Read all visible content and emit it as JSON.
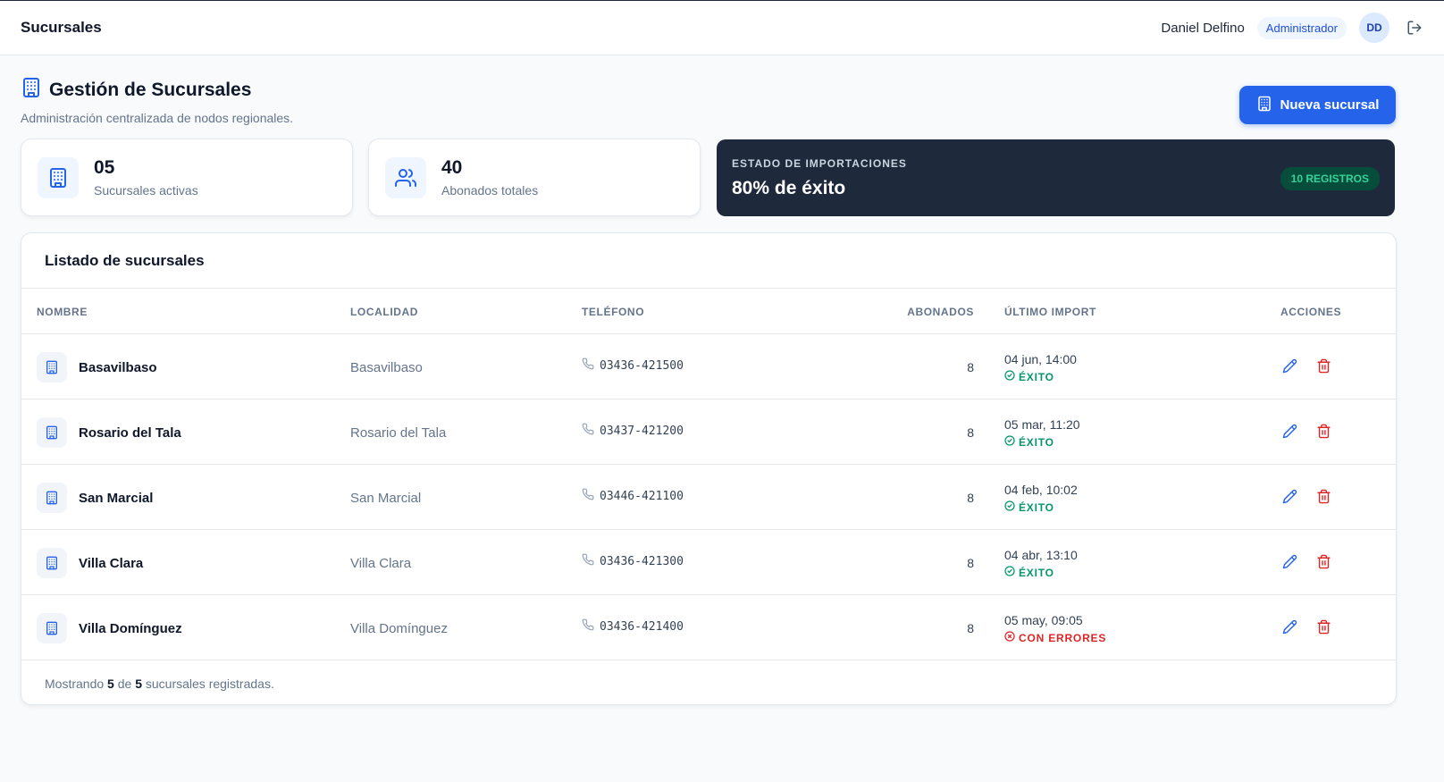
{
  "header": {
    "app_title": "Sucursales",
    "user_name": "Daniel Delfino",
    "role": "Administrador",
    "avatar_initials": "DD",
    "logout_icon": "logout-icon"
  },
  "page": {
    "title": "Gestión de Sucursales",
    "subtitle": "Administración centralizada de nodos regionales.",
    "new_button": "Nueva sucursal"
  },
  "stats": {
    "branches": {
      "value": "05",
      "label": "Sucursales activas"
    },
    "subscribers": {
      "value": "40",
      "label": "Abonados totales"
    }
  },
  "imports": {
    "caption": "ESTADO DE IMPORTACIONES",
    "success_text": "80% de éxito",
    "badge": "10 REGISTROS"
  },
  "table": {
    "title": "Listado de sucursales",
    "columns": [
      "NOMBRE",
      "LOCALIDAD",
      "TELÉFONO",
      "ABONADOS",
      "ÚLTIMO IMPORT",
      "ACCIONES"
    ],
    "rows": [
      {
        "name": "Basavilbaso",
        "locality": "Basavilbaso",
        "phone": "03436-421500",
        "subscribers": "8",
        "import_date": "04 jun, 14:00",
        "import_status": "ÉXITO",
        "ok": true
      },
      {
        "name": "Rosario del Tala",
        "locality": "Rosario del Tala",
        "phone": "03437-421200",
        "subscribers": "8",
        "import_date": "05 mar, 11:20",
        "import_status": "ÉXITO",
        "ok": true
      },
      {
        "name": "San Marcial",
        "locality": "San Marcial",
        "phone": "03446-421100",
        "subscribers": "8",
        "import_date": "04 feb, 10:02",
        "import_status": "ÉXITO",
        "ok": true
      },
      {
        "name": "Villa Clara",
        "locality": "Villa Clara",
        "phone": "03436-421300",
        "subscribers": "8",
        "import_date": "04 abr, 13:10",
        "import_status": "ÉXITO",
        "ok": true
      },
      {
        "name": "Villa Domínguez",
        "locality": "Villa Domínguez",
        "phone": "03436-421400",
        "subscribers": "8",
        "import_date": "05 may, 09:05",
        "import_status": "CON ERRORES",
        "ok": false
      }
    ],
    "footer": {
      "prefix": "Mostrando",
      "shown": "5",
      "middle": "de",
      "total": "5",
      "suffix": "sucursales registradas."
    }
  },
  "colors": {
    "accent": "#2563eb",
    "success": "#059669",
    "error": "#dc2626",
    "dark_card": "#1e293b"
  }
}
